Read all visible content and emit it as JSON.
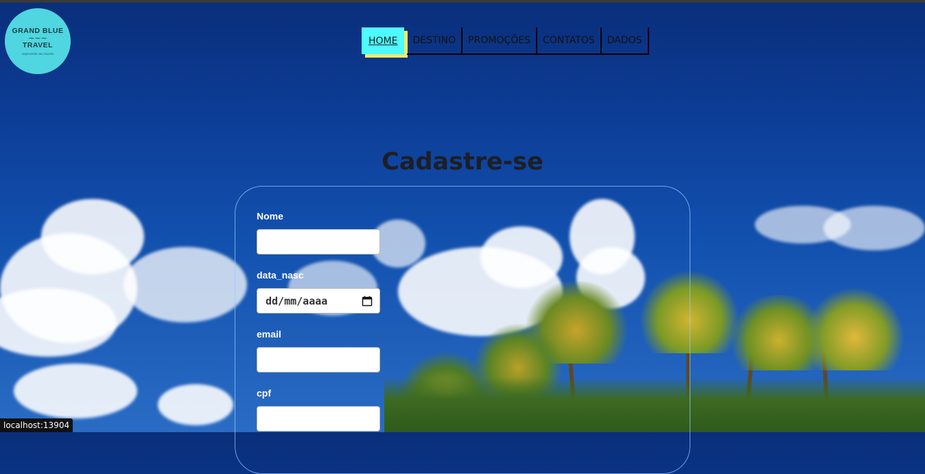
{
  "logo": {
    "line1": "GRAND BLUE",
    "wave": "~~~",
    "line2": "TRAVEL",
    "tagline": "explorando seu mundo",
    "color": "#4fd6e0"
  },
  "nav": {
    "items": [
      {
        "label": "HOME",
        "active": true
      },
      {
        "label": "DESTINO",
        "active": false
      },
      {
        "label": "PROMOÇÕES",
        "active": false
      },
      {
        "label": "CONTATOS",
        "active": false
      },
      {
        "label": "DADOS",
        "active": false
      }
    ],
    "active_color": "#4dfaff",
    "shadow_color": "#f2e86a"
  },
  "page": {
    "title": "Cadastre-se"
  },
  "form": {
    "fields": [
      {
        "label": "Nome",
        "value": "",
        "type": "text"
      },
      {
        "label": "data_nasc",
        "value": "dd/mm/aaaa",
        "type": "date"
      },
      {
        "label": "email",
        "value": "",
        "type": "email"
      },
      {
        "label": "cpf",
        "value": "",
        "type": "text"
      }
    ]
  },
  "status_bar": {
    "url": "localhost:13904"
  }
}
